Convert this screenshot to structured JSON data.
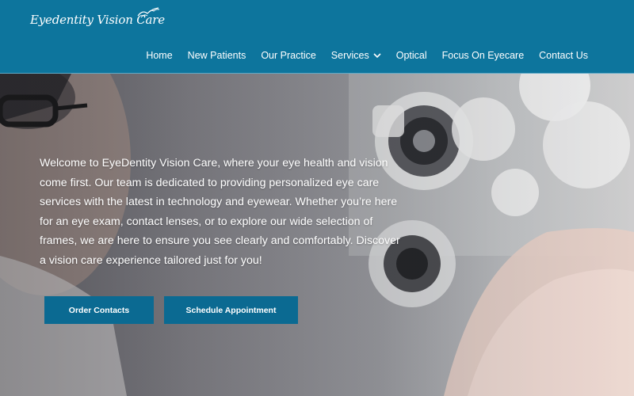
{
  "brand": {
    "logo_text": "Eyedentity Vision Care",
    "colors": {
      "header_bg": "#0d759d",
      "button_bg": "#0b6a92",
      "text": "#ffffff"
    }
  },
  "nav": {
    "items": [
      {
        "label": "Home"
      },
      {
        "label": "New Patients"
      },
      {
        "label": "Our Practice"
      },
      {
        "label": "Services",
        "icon": "chevron-down-icon"
      },
      {
        "label": "Optical"
      },
      {
        "label": "Focus On Eyecare"
      },
      {
        "label": "Contact Us"
      }
    ]
  },
  "hero": {
    "intro": "Welcome to EyeDentity Vision Care, where your eye health and vision come first. Our team is dedicated to providing personalized eye care services with the latest in technology and eyewear. Whether you’re here for an eye exam, contact lenses, or to explore our wide selection of frames, we are here to ensure you see clearly and comfortably. Discover a vision care experience tailored just for you!",
    "buttons": {
      "order_contacts": "Order Contacts",
      "schedule_appointment": "Schedule Appointment"
    }
  }
}
